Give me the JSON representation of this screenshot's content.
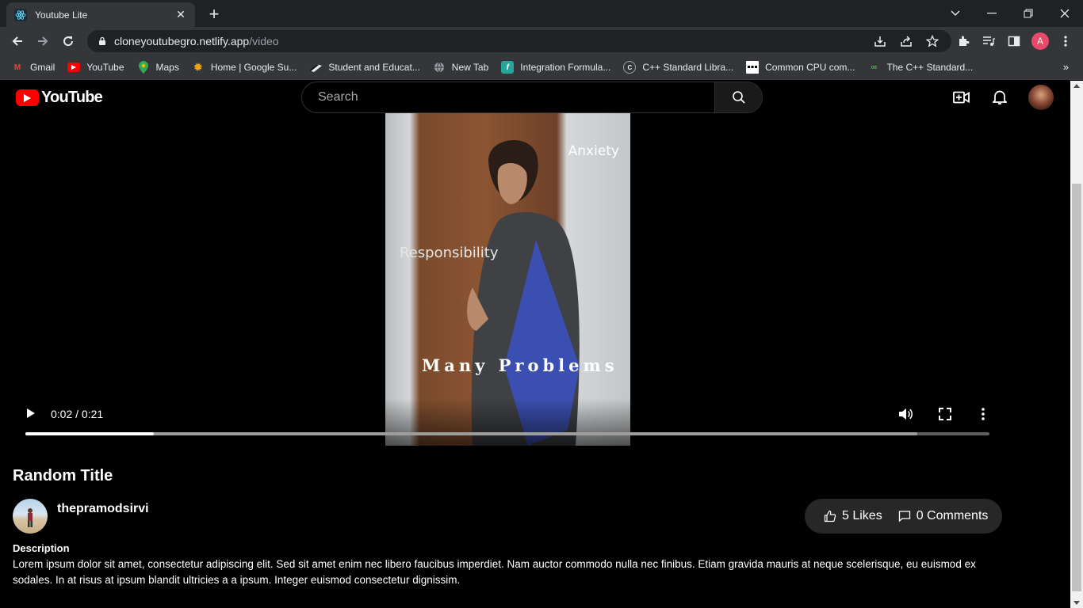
{
  "browser": {
    "tab_title": "Youtube Lite",
    "url_host": "cloneyoutubegro.netlify.app",
    "url_path": "/video",
    "profile_initial": "A",
    "bookmarks": [
      {
        "label": "Gmail",
        "icon": "gmail-icon"
      },
      {
        "label": "YouTube",
        "icon": "youtube-icon"
      },
      {
        "label": "Maps",
        "icon": "maps-icon"
      },
      {
        "label": "Home | Google Su...",
        "icon": "google-suite-icon"
      },
      {
        "label": "Student and Educat...",
        "icon": "student-icon"
      },
      {
        "label": "New Tab",
        "icon": "globe-icon"
      },
      {
        "label": "Integration Formula...",
        "icon": "integration-icon"
      },
      {
        "label": "C++ Standard Libra...",
        "icon": "cpp-icon"
      },
      {
        "label": "Common CPU com...",
        "icon": "cpu-icon"
      },
      {
        "label": "The C++ Standard...",
        "icon": "cpp-standard-icon"
      }
    ]
  },
  "header": {
    "logo_text": "YouTube",
    "search_placeholder": "Search"
  },
  "video": {
    "time": "0:02 / 0:21",
    "progress_fraction": 0.133,
    "buffered_fraction": 0.925,
    "overlay_texts": [
      "Anxiety",
      "Responsibility",
      "Many Problems"
    ]
  },
  "info": {
    "title": "Random Title",
    "channel": "thepramodsirvi",
    "likes": "5 Likes",
    "comments": "0 Comments",
    "description_heading": "Description",
    "description": "Lorem ipsum dolor sit amet, consectetur adipiscing elit. Sed sit amet enim nec libero faucibus imperdiet. Nam auctor commodo nulla nec finibus. Etiam gravida mauris at neque scelerisque, eu euismod ex sodales. In at risus at ipsum blandit ultricies a a ipsum. Integer euismod consectetur dignissim."
  },
  "colors": {
    "brand_red": "#ff0000",
    "page_bg": "#000000",
    "chrome_bg": "#35363a"
  }
}
